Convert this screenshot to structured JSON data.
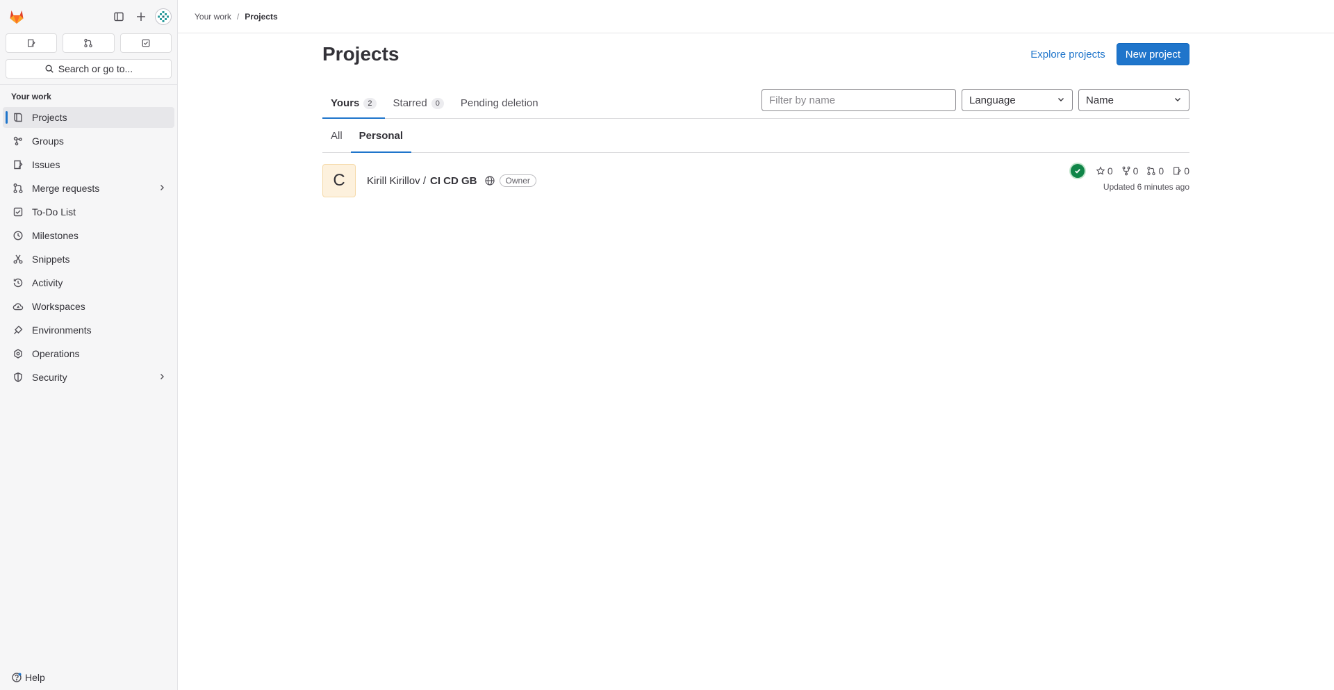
{
  "breadcrumb": {
    "parent": "Your work",
    "separator": "/",
    "current": "Projects"
  },
  "sidebar": {
    "search_label": "Search or go to...",
    "section_title": "Your work",
    "items": [
      {
        "label": "Projects",
        "icon": "project-icon",
        "active": true
      },
      {
        "label": "Groups",
        "icon": "group-icon"
      },
      {
        "label": "Issues",
        "icon": "issues-icon"
      },
      {
        "label": "Merge requests",
        "icon": "merge-request-icon",
        "has_submenu": true
      },
      {
        "label": "To-Do List",
        "icon": "todo-icon"
      },
      {
        "label": "Milestones",
        "icon": "clock-icon"
      },
      {
        "label": "Snippets",
        "icon": "snippet-icon"
      },
      {
        "label": "Activity",
        "icon": "history-icon"
      },
      {
        "label": "Workspaces",
        "icon": "cloud-icon"
      },
      {
        "label": "Environments",
        "icon": "environment-icon"
      },
      {
        "label": "Operations",
        "icon": "cloud-gear-icon"
      },
      {
        "label": "Security",
        "icon": "shield-icon",
        "has_submenu": true
      }
    ],
    "help_label": "Help"
  },
  "page": {
    "title": "Projects",
    "explore_label": "Explore projects",
    "new_project_label": "New project",
    "tabs": [
      {
        "label": "Yours",
        "count": "2",
        "active": true
      },
      {
        "label": "Starred",
        "count": "0"
      },
      {
        "label": "Pending deletion"
      }
    ],
    "filter_placeholder": "Filter by name",
    "language_label": "Language",
    "sort_label": "Name",
    "subtabs": [
      {
        "label": "All"
      },
      {
        "label": "Personal",
        "active": true
      }
    ]
  },
  "project": {
    "avatar_letter": "C",
    "namespace": "Kirill Kirillov /",
    "name": "CI CD GB",
    "role": "Owner",
    "stars": "0",
    "forks": "0",
    "merge_requests": "0",
    "issues": "0",
    "updated": "Updated 6 minutes ago",
    "pipeline_status": "success"
  },
  "colors": {
    "accent": "#1f75cb",
    "success": "#108548",
    "sidebar_bg": "#f6f6f7"
  }
}
